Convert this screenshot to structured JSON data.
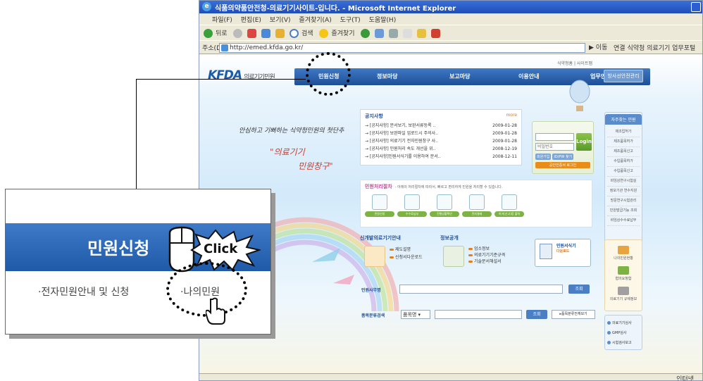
{
  "window": {
    "title": "식품의약품안전청-의료기기사이트-입니다. - Microsoft Internet Explorer",
    "menu": [
      "파일(F)",
      "편집(E)",
      "보기(V)",
      "즐겨찾기(A)",
      "도구(T)",
      "도움말(H)"
    ],
    "toolbar": {
      "back": "뒤로",
      "search": "검색",
      "favorites": "즐겨찾기"
    },
    "address_label": "주소(D)",
    "address": "http://emed.kfda.go.kr/",
    "go": "이동",
    "links": "연결",
    "link1": "식약청",
    "link2": "의료기기 업무포털",
    "status_zone": "인터넷"
  },
  "site": {
    "logo": "KFDA",
    "logo_sub": "의료기기민원",
    "top_links": "식약청홈  |  사이트맵",
    "nav": [
      "민원신청",
      "정보마당",
      "보고마당",
      "이용안내",
      "업무안내"
    ],
    "nav_special": "방사선안전관리",
    "slogan1": "안심하고 기뻐하는 식약청민원의 첫단추",
    "slogan2": "\"의료기기",
    "slogan3": "민원창구\"",
    "notice": {
      "title": "공지사항",
      "more": "more",
      "items": [
        {
          "text": "→ [공지사항] 문서보기, 보완서류등록 ..",
          "date": "2009-01-28"
        },
        {
          "text": "→ [공지사항] 보완파일 업로드시 주의사..",
          "date": "2009-01-28"
        },
        {
          "text": "→ [공지사항] 의료기기 전자민원창구 사..",
          "date": "2009-01-28"
        },
        {
          "text": "→ [공지사항] 민원처리 속도 개선을 위..",
          "date": "2008-12-19"
        },
        {
          "text": "→ [공지사항]민원서식기를 이용하여 문서..",
          "date": "2008-12-11"
        }
      ]
    },
    "login": {
      "pw_placeholder": "비밀번호",
      "button": "Login",
      "join": "회원가입",
      "find": "ID/PW 찾기",
      "cert": "공인인증서 로그인"
    },
    "right_menu": {
      "title": "자주찾는 민원",
      "items": [
        "제조업허가",
        "제조품목허가",
        "제조품목신고",
        "수입품목허가",
        "수입품목신고",
        "비임상연구시험실",
        "정보기관 연수지원",
        "방문연구시험관리",
        "민원발급기능 조회",
        "비임상수수료납부"
      ]
    },
    "process": {
      "title": "민원처리절차",
      "desc": "- 아래의 처리절차에 따라서, 빠르고 편리하게 민원을 처리할 수 있습니다.",
      "steps": [
        "민원신청",
        "수수료납부",
        "진행상황확인",
        "전자결재",
        "허가(신고)증 출력"
      ]
    },
    "guide": {
      "title": "신개발의료기기안내",
      "items": [
        "제도설명",
        "신청서다운로드"
      ]
    },
    "open": {
      "title": "정보공개",
      "items": [
        "업소정보",
        "의료기기기준규격",
        "기술문서해설서"
      ]
    },
    "download": {
      "title": "민원서식기",
      "sub": "다운로드"
    },
    "search1": {
      "label": "민원사무명",
      "button": "조회"
    },
    "search2": {
      "label": "품목분류검색",
      "select": "품목명",
      "button": "조회",
      "all": "▸품목분류전체보기"
    },
    "my_area": [
      "나의민원현황",
      "협의요청함",
      "의료기기 규제정보"
    ],
    "bottom_side": [
      "의료기기심사",
      "GMP심사",
      "시험검사보고"
    ]
  },
  "overlay": {
    "menu_label": "민원신청",
    "click_text": "Click",
    "sub_link1": "·전자민원안내 및 신청",
    "sub_link2": "·나의민원"
  }
}
